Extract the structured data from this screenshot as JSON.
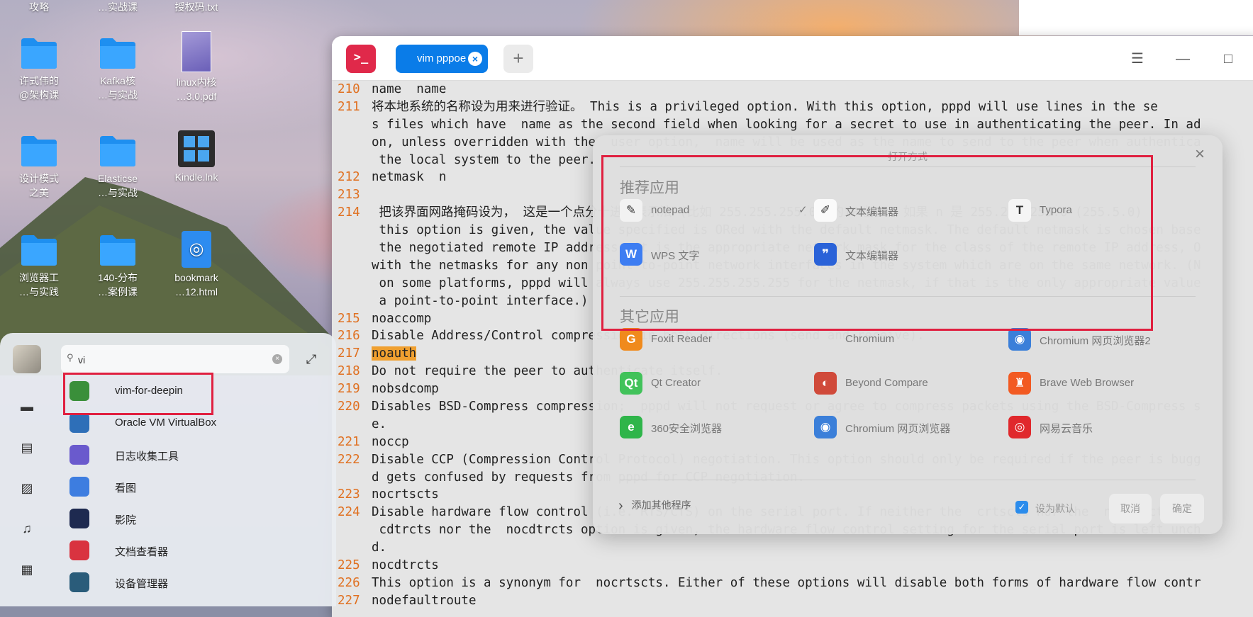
{
  "desktop": {
    "top_labels": [
      "攻略",
      "…实战课",
      "授权码.txt"
    ],
    "icons": [
      {
        "label": "许式伟的\n@架构课",
        "type": "folder"
      },
      {
        "label": "Kafka核\n…与实战",
        "type": "folder"
      },
      {
        "label": "linux内核\n…3.0.pdf",
        "type": "pdf"
      },
      {
        "label": "设计模式\n之美",
        "type": "folder"
      },
      {
        "label": "Elasticse\n…与实战",
        "type": "folder"
      },
      {
        "label": "Kindle.lnk",
        "type": "windows-link"
      },
      {
        "label": "浏览器工\n…与实践",
        "type": "folder"
      },
      {
        "label": "140-分布\n…案例课",
        "type": "folder"
      },
      {
        "label": "bookmark\n…12.html",
        "type": "html"
      }
    ]
  },
  "terminal": {
    "tab_label": "vim pppoe",
    "tab_close": "×",
    "add_tab": "+",
    "logo_text": ">_",
    "menu_icon": "☰",
    "minimize_icon": "—",
    "maximize_icon": "□",
    "lines": [
      {
        "num": "210",
        "text": "name  name"
      },
      {
        "num": "211",
        "text": "将本地系统的名称设为用来进行验证。 This is a privileged option. With this option, pppd will use lines in the se"
      },
      {
        "num": "",
        "text": "s files which have  name as the second field when looking for a secret to use in authenticating the peer. In ad"
      },
      {
        "num": "",
        "text": "on, unless overridden with the  user option,  name will be used as the name to send to the peer when authentica"
      },
      {
        "num": "",
        "text": " the local system to the peer."
      },
      {
        "num": "212",
        "text": "netmask  n"
      },
      {
        "num": "213",
        "text": ""
      },
      {
        "num": "214",
        "text": " 把该界面网路掩码设为， 这是一个点分十进制表示法 (比如 255.255.255.0) 的IP地址。 如果 n 是 255.255.255.0 (255.5.0)"
      },
      {
        "num": "",
        "text": " this option is given, the value specified is ORed with the default netmask. The default netmask is chosen base"
      },
      {
        "num": "",
        "text": " the negotiated remote IP address; it is the appropriate network mask for the class of the remote IP address, O"
      },
      {
        "num": "",
        "text": "with the netmasks for any non point-to-point network interfaces in the system which are on the same network. (N"
      },
      {
        "num": "",
        "text": " on some platforms, pppd will always use 255.255.255.255 for the netmask, if that is the only appropriate value"
      },
      {
        "num": "",
        "text": " a point-to-point interface.)"
      },
      {
        "num": "215",
        "text": "noaccomp"
      },
      {
        "num": "216",
        "text": "Disable Address/Control compression in both directions (send and receive)."
      },
      {
        "num": "217",
        "text": "noauth",
        "highlight": true
      },
      {
        "num": "218",
        "text": "Do not require the peer to authenticate itself."
      },
      {
        "num": "219",
        "text": "nobsdcomp"
      },
      {
        "num": "220",
        "text": "Disables BSD-Compress compression;  pppd will not request or agree to compress packets using the BSD-Compress s"
      },
      {
        "num": "",
        "text": "e."
      },
      {
        "num": "221",
        "text": "noccp"
      },
      {
        "num": "222",
        "text": "Disable CCP (Compression Control Protocol) negotiation. This option should only be required if the peer is bugg"
      },
      {
        "num": "",
        "text": "d gets confused by requests from pppd for CCP negotiation."
      },
      {
        "num": "223",
        "text": "nocrtscts"
      },
      {
        "num": "224",
        "text": "Disable hardware flow control (i.e. RTS/CTS) on the serial port. If neither the  crtscts nor the  nocrtscts nor"
      },
      {
        "num": "",
        "text": " cdtrcts nor the  nocdtrcts option is given, the hardware flow control setting for the serial port is left unch"
      },
      {
        "num": "",
        "text": "d."
      },
      {
        "num": "225",
        "text": "nocdtrcts"
      },
      {
        "num": "226",
        "text": "This option is a synonym for  nocrtscts. Either of these options will disable both forms of hardware flow contr"
      },
      {
        "num": "227",
        "text": "nodefaultroute"
      }
    ]
  },
  "launcher": {
    "search_value": "vi",
    "search_icon": "⚲",
    "clear_icon": "×",
    "expand_icon": "⤢",
    "sidebar_icons": [
      "computer-icon",
      "document-icon",
      "picture-icon",
      "music-icon",
      "video-icon"
    ],
    "sidebar_glyphs": [
      "▬",
      "▤",
      "▨",
      "♫",
      "▦"
    ],
    "apps": [
      {
        "name": "vim-for-deepin",
        "color": "#3a8f3a"
      },
      {
        "name": "Oracle VM VirtualBox",
        "color": "#2e6fb8"
      },
      {
        "name": "日志收集工具",
        "color": "#6a5acd"
      },
      {
        "name": "看图",
        "color": "#3d7de0"
      },
      {
        "name": "影院",
        "color": "#1e2a50"
      },
      {
        "name": "文档查看器",
        "color": "#d93340"
      },
      {
        "name": "设备管理器",
        "color": "#2a5c7a"
      }
    ]
  },
  "dialog": {
    "title": "打开方式",
    "close_icon": "×",
    "recommended_title": "推荐应用",
    "other_title": "其它应用",
    "recommended": [
      {
        "name": "notepad",
        "icon_color": "#f2f2f2",
        "glyph": "✎",
        "checked": false
      },
      {
        "name": "文本编辑器",
        "icon_color": "#fafafa",
        "glyph": "✐",
        "checked": true
      },
      {
        "name": "Typora",
        "icon_color": "#f5f5f5",
        "glyph": "T",
        "checked": false
      },
      {
        "name": "WPS 文字",
        "icon_color": "#3d7df2",
        "glyph": "W",
        "checked": false
      },
      {
        "name": "文本编辑器",
        "icon_color": "#2a62d8",
        "glyph": "❞",
        "checked": false
      }
    ],
    "others": [
      {
        "name": "Foxit Reader",
        "icon_color": "#f08a1c",
        "glyph": "G"
      },
      {
        "name": "Chromium",
        "icon_color": "",
        "glyph": ""
      },
      {
        "name": "Chromium 网页浏览器2",
        "icon_color": "#3b7fd9",
        "glyph": "◉"
      },
      {
        "name": "Qt Creator",
        "icon_color": "#41c25a",
        "glyph": "Qt"
      },
      {
        "name": "Beyond Compare",
        "icon_color": "#d04a3a",
        "glyph": "◐"
      },
      {
        "name": "Brave Web Browser",
        "icon_color": "#f25a22",
        "glyph": "♜"
      },
      {
        "name": "360安全浏览器",
        "icon_color": "#2fb54a",
        "glyph": "e"
      },
      {
        "name": "Chromium 网页浏览器",
        "icon_color": "#3b7fd9",
        "glyph": "◉"
      },
      {
        "name": "网易云音乐",
        "icon_color": "#e0282c",
        "glyph": "◎"
      }
    ],
    "add_other": "添加其他程序",
    "set_default": "设为默认",
    "set_default_checked": true,
    "cancel": "取消",
    "confirm": "确定"
  }
}
